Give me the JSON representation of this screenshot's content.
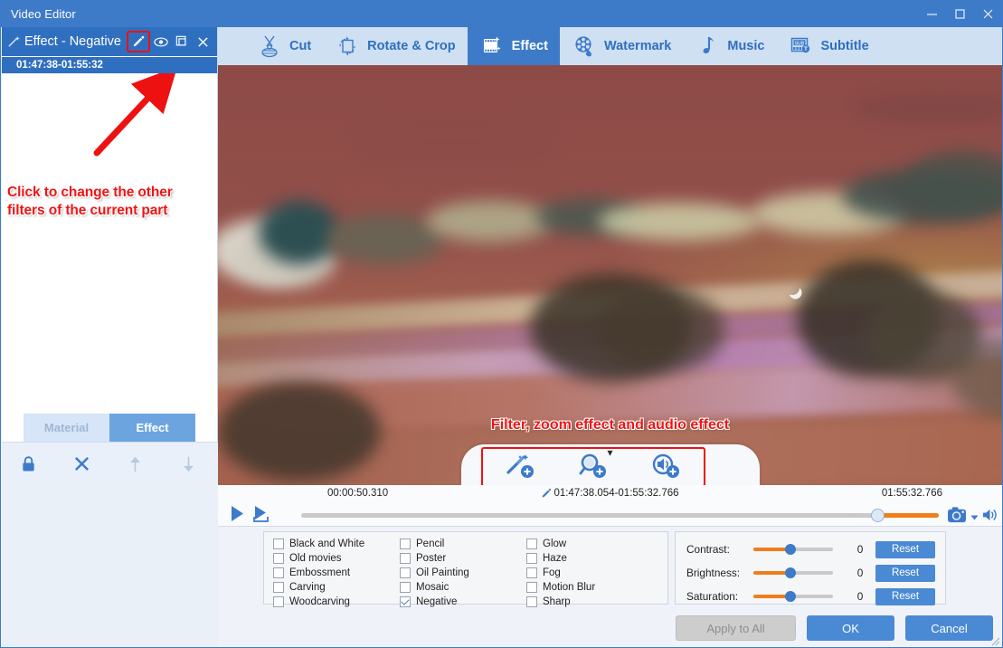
{
  "window": {
    "title": "Video Editor",
    "controls": [
      {
        "name": "minimize",
        "glyph": "minimize-icon"
      },
      {
        "name": "maximize",
        "glyph": "maximize-icon"
      },
      {
        "name": "close",
        "glyph": "close-icon"
      }
    ]
  },
  "sidebar": {
    "header_title": "Effect - Negative",
    "header_icon": "magic-wand-icon",
    "icons": [
      {
        "name": "edit-pencil-icon",
        "highlighted": true
      },
      {
        "name": "eye-visibility-icon",
        "highlighted": false
      },
      {
        "name": "copy-duplicate-icon",
        "highlighted": false
      },
      {
        "name": "delete-close-icon",
        "highlighted": false
      }
    ],
    "clip_time": "01:47:38-01:55:32",
    "annotation": "Click to change the other\nfilters of the current part",
    "annotation_line1": "Click to change the other",
    "annotation_line2": "filters of the current part",
    "tabs": [
      {
        "label": "Material",
        "active": false
      },
      {
        "label": "Effect",
        "active": true
      }
    ],
    "tools": [
      {
        "name": "lock-icon",
        "enabled": true
      },
      {
        "name": "remove-x-icon",
        "enabled": true
      },
      {
        "name": "move-up-arrow-icon",
        "enabled": false
      },
      {
        "name": "move-down-arrow-icon",
        "enabled": false
      }
    ]
  },
  "toolbar": {
    "tabs": [
      {
        "label": "Cut",
        "icon": "scissors-icon",
        "active": false
      },
      {
        "label": "Rotate & Crop",
        "icon": "rotate-crop-icon",
        "active": false
      },
      {
        "label": "Effect",
        "icon": "film-effect-icon",
        "active": true
      },
      {
        "label": "Watermark",
        "icon": "film-reel-icon",
        "active": false
      },
      {
        "label": "Music",
        "icon": "music-note-icon",
        "active": false
      },
      {
        "label": "Subtitle",
        "icon": "subtitle-icon",
        "active": false
      }
    ]
  },
  "preview": {
    "annotation": "Filter, zoom effect and audio effect",
    "effect_buttons": [
      {
        "name": "add-filter-icon"
      },
      {
        "name": "add-zoom-effect-icon"
      },
      {
        "name": "add-audio-effect-icon"
      }
    ],
    "collapse_chevron": "chevron-down-icon"
  },
  "playback": {
    "current_time": "00:00:50.310",
    "selection_range": "01:47:38.054-01:55:32.766",
    "selection_edit_icon": "pencil-edit-icon",
    "total_time": "01:55:32.766",
    "buttons": [
      {
        "name": "play-button",
        "icon": "play-icon"
      },
      {
        "name": "play-selection-button",
        "icon": "play-selection-icon"
      },
      {
        "name": "stop-button",
        "icon": "stop-icon"
      }
    ],
    "right_icons": [
      {
        "name": "snapshot-camera-icon"
      },
      {
        "name": "snapshot-dropdown-icon"
      },
      {
        "name": "volume-speaker-icon"
      }
    ]
  },
  "filters": {
    "columns": [
      [
        {
          "label": "Black and White",
          "checked": false
        },
        {
          "label": "Old movies",
          "checked": false
        },
        {
          "label": "Embossment",
          "checked": false
        },
        {
          "label": "Carving",
          "checked": false
        },
        {
          "label": "Woodcarving",
          "checked": false
        }
      ],
      [
        {
          "label": "Pencil",
          "checked": false
        },
        {
          "label": "Poster",
          "checked": false
        },
        {
          "label": "Oil Painting",
          "checked": false
        },
        {
          "label": "Mosaic",
          "checked": false
        },
        {
          "label": "Negative",
          "checked": true
        }
      ],
      [
        {
          "label": "Glow",
          "checked": false
        },
        {
          "label": "Haze",
          "checked": false
        },
        {
          "label": "Fog",
          "checked": false
        },
        {
          "label": "Motion Blur",
          "checked": false
        },
        {
          "label": "Sharp",
          "checked": false
        }
      ]
    ]
  },
  "adjustments": {
    "rows": [
      {
        "label": "Contrast:",
        "value": "0",
        "reset_label": "Reset"
      },
      {
        "label": "Brightness:",
        "value": "0",
        "reset_label": "Reset"
      },
      {
        "label": "Saturation:",
        "value": "0",
        "reset_label": "Reset"
      }
    ]
  },
  "actions": {
    "apply_to_all": "Apply to All",
    "ok": "OK",
    "cancel": "Cancel"
  },
  "colors": {
    "accent": "#3d7bc8",
    "accent_light": "#6ca4e0",
    "toolbar_bg": "#cfe0f2",
    "annotation_red": "#f01414",
    "slider_orange": "#f07d1a",
    "button_blue": "#4a8ad4"
  }
}
